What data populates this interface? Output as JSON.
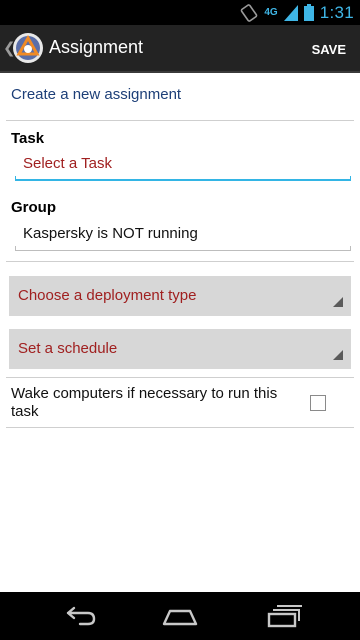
{
  "status_bar": {
    "network": "4G",
    "time": "1:31",
    "accent_color": "#3fb6e6"
  },
  "action_bar": {
    "title": "Assignment",
    "save_label": "SAVE",
    "logo_icon": "app-logo-icon"
  },
  "form": {
    "heading": "Create a new assignment",
    "task": {
      "label": "Task",
      "placeholder": "Select a Task"
    },
    "group": {
      "label": "Group",
      "value": "Kaspersky is NOT running"
    },
    "deployment_type": {
      "value": "Choose a deployment type"
    },
    "schedule": {
      "value": "Set a schedule"
    },
    "wake": {
      "label": "Wake computers if necessary to run this task",
      "checked": false
    }
  },
  "nav_bar": {
    "icons": [
      "back-icon",
      "home-icon",
      "recent-apps-icon"
    ]
  },
  "colors": {
    "action_bar": "#232323",
    "heading": "#1d3f78",
    "placeholder": "#a02020",
    "focus_underline": "#33b5e5",
    "spinner_bg": "#d7d7d7"
  }
}
